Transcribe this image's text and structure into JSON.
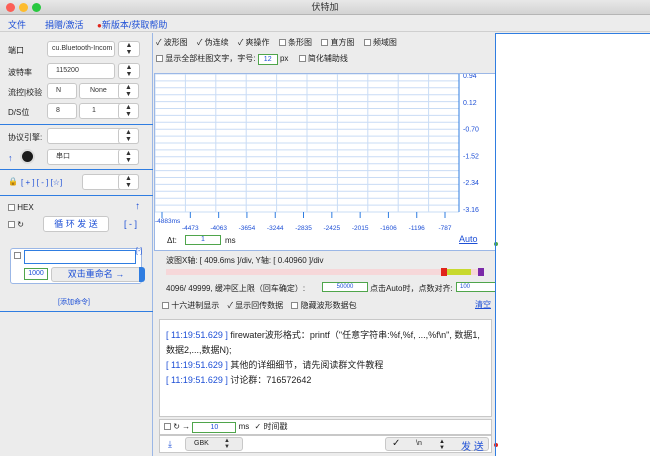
{
  "window": {
    "title": "伏特加"
  },
  "menu": {
    "file": "文件",
    "donate": "捐赠/激活",
    "update": "新版本/获取帮助"
  },
  "left": {
    "port_label": "端口",
    "port_value": "cu.Bluetooth-Incom",
    "baud_label": "波特率",
    "baud_value": "115200",
    "flow_label": "流控|校验",
    "flow_value": "N",
    "parity_value": "None",
    "ds_label": "D/S位",
    "data_bits": "8",
    "stop_bits": "1",
    "protocol_label": "协议引擎:",
    "serial_label": "串口",
    "cmd_buttons": "[ + ] [ - ] [☆]",
    "hex_label": "HEX",
    "loop_send": "循 环 发 送",
    "minus": "[ - ]",
    "cmd_minus": "[-]",
    "period_value": "1000",
    "rename": "双击重命名 →",
    "add_cmd": "[添加命令]"
  },
  "main": {
    "modes": [
      "波形图",
      "伪连续",
      "爽操作",
      "条形图",
      "直方图",
      "频域图"
    ],
    "modes_checked": [
      true,
      true,
      true,
      false,
      false,
      false
    ],
    "show_bar_text": "显示全部柱图文字，字号:",
    "font_size": "12",
    "px": "px",
    "simplify": "简化辅助线",
    "y_ticks": [
      "0.94",
      "0.12",
      "-0.70",
      "-1.52",
      "-2.34",
      "-3.16"
    ],
    "x_ticks": [
      "-4883ms",
      "-4473",
      "-4063",
      "-3654",
      "-3244",
      "-2835",
      "-2425",
      "-2015",
      "-1606",
      "-1196",
      "-787"
    ],
    "delta_t_label": "Δt:",
    "delta_t_value": "1",
    "delta_t_unit": "ms",
    "auto": "Auto",
    "scale_text": "波图X轴: [ 409.6ms ]/div,   Y轴: [ 0.40960 ]/div",
    "buffer_text": "4096/ 49999,   缓冲区上限（回车确定）:",
    "buffer_value": "50000",
    "auto_hint": "点击Auto时，点数对齐:",
    "auto_align": "100",
    "opt_hex": "十六进制显示",
    "opt_echo": "显示回传数据",
    "opt_hide": "隐藏波形数据包",
    "clear": "清空",
    "log": [
      {
        "time": "[ 11:19:51.629 ]",
        "text": " firewater波形格式：printf（\"任意字符串:%f,%f, ...,%f\\n\", 数据1, 数据2,...,数据N);"
      },
      {
        "time": "[ 11:19:51.629 ]",
        "text": " 其他的详细细节，请先阅读群文件教程"
      },
      {
        "time": "[ 11:19:51.629 ]",
        "text": " 讨论群：716572642"
      }
    ],
    "send_period": "10",
    "send_unit": "ms",
    "timestamp": "时间戳",
    "encoding": "GBK",
    "line_end": "\\n",
    "send": "发 送"
  },
  "chart_data": {
    "type": "line",
    "x": [],
    "series": [],
    "xlim": [
      -4883,
      -787
    ],
    "ylim": [
      -3.16,
      0.94
    ],
    "y_ticks": [
      0.94,
      0.12,
      -0.7,
      -1.52,
      -2.34,
      -3.16
    ],
    "x_ticks": [
      -4883,
      -4473,
      -4063,
      -3654,
      -3244,
      -2835,
      -2425,
      -2015,
      -1606,
      -1196,
      -787
    ],
    "grid": true
  }
}
